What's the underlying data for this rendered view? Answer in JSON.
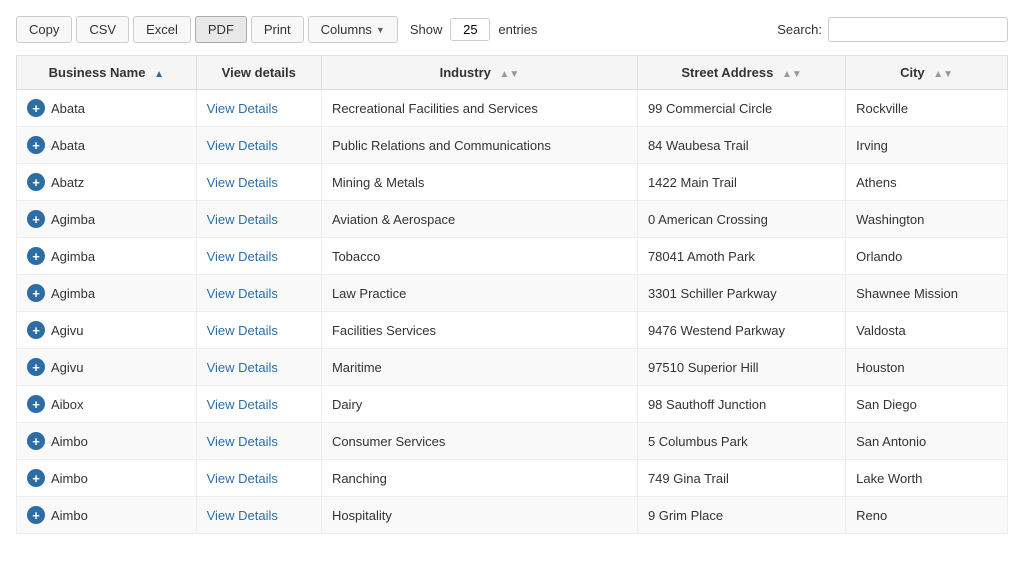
{
  "toolbar": {
    "copy_label": "Copy",
    "csv_label": "CSV",
    "excel_label": "Excel",
    "pdf_label": "PDF",
    "print_label": "Print",
    "columns_label": "Columns",
    "show_label": "Show",
    "entries_value": "25",
    "entries_label": "entries",
    "search_label": "Search:",
    "search_placeholder": ""
  },
  "table": {
    "columns": [
      {
        "id": "business_name",
        "label": "Business Name",
        "sort": "asc"
      },
      {
        "id": "view_details",
        "label": "View details",
        "sort": "none"
      },
      {
        "id": "industry",
        "label": "Industry",
        "sort": "both"
      },
      {
        "id": "street_address",
        "label": "Street Address",
        "sort": "both"
      },
      {
        "id": "city",
        "label": "City",
        "sort": "both"
      }
    ],
    "rows": [
      {
        "business_name": "Abata",
        "view_details": "View Details",
        "industry": "Recreational Facilities and Services",
        "street_address": "99 Commercial Circle",
        "city": "Rockville"
      },
      {
        "business_name": "Abata",
        "view_details": "View Details",
        "industry": "Public Relations and Communications",
        "street_address": "84 Waubesa Trail",
        "city": "Irving"
      },
      {
        "business_name": "Abatz",
        "view_details": "View Details",
        "industry": "Mining & Metals",
        "street_address": "1422 Main Trail",
        "city": "Athens"
      },
      {
        "business_name": "Agimba",
        "view_details": "View Details",
        "industry": "Aviation & Aerospace",
        "street_address": "0 American Crossing",
        "city": "Washington"
      },
      {
        "business_name": "Agimba",
        "view_details": "View Details",
        "industry": "Tobacco",
        "street_address": "78041 Amoth Park",
        "city": "Orlando"
      },
      {
        "business_name": "Agimba",
        "view_details": "View Details",
        "industry": "Law Practice",
        "street_address": "3301 Schiller Parkway",
        "city": "Shawnee Mission"
      },
      {
        "business_name": "Agivu",
        "view_details": "View Details",
        "industry": "Facilities Services",
        "street_address": "9476 Westend Parkway",
        "city": "Valdosta"
      },
      {
        "business_name": "Agivu",
        "view_details": "View Details",
        "industry": "Maritime",
        "street_address": "97510 Superior Hill",
        "city": "Houston"
      },
      {
        "business_name": "Aibox",
        "view_details": "View Details",
        "industry": "Dairy",
        "street_address": "98 Sauthoff Junction",
        "city": "San Diego"
      },
      {
        "business_name": "Aimbo",
        "view_details": "View Details",
        "industry": "Consumer Services",
        "street_address": "5 Columbus Park",
        "city": "San Antonio"
      },
      {
        "business_name": "Aimbo",
        "view_details": "View Details",
        "industry": "Ranching",
        "street_address": "749 Gina Trail",
        "city": "Lake Worth"
      },
      {
        "business_name": "Aimbo",
        "view_details": "View Details",
        "industry": "Hospitality",
        "street_address": "9 Grim Place",
        "city": "Reno"
      }
    ]
  }
}
